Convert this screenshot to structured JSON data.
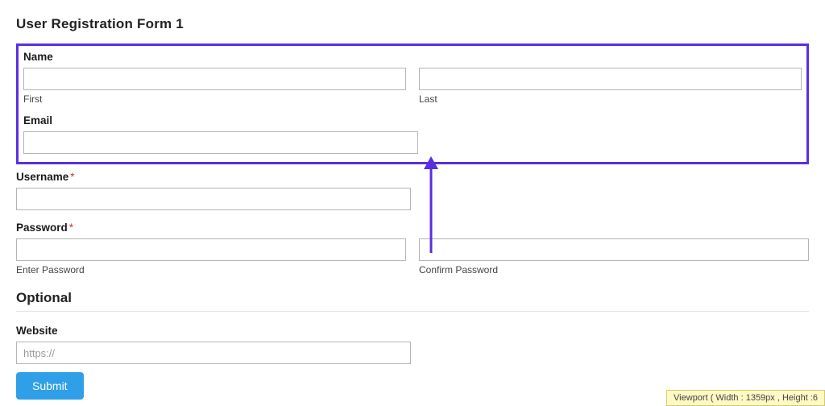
{
  "page_title": "User Registration Form 1",
  "highlight_section": {
    "name": {
      "label": "Name",
      "first_sub": "First",
      "last_sub": "Last"
    },
    "email": {
      "label": "Email"
    }
  },
  "username": {
    "label": "Username",
    "required": "*"
  },
  "password": {
    "label": "Password",
    "required": "*",
    "enter_sub": "Enter Password",
    "confirm_sub": "Confirm Password"
  },
  "optional_heading": "Optional",
  "website": {
    "label": "Website",
    "placeholder": "https://"
  },
  "submit_label": "Submit",
  "viewport_text": "Viewport ( Width : 1359px , Height :6"
}
